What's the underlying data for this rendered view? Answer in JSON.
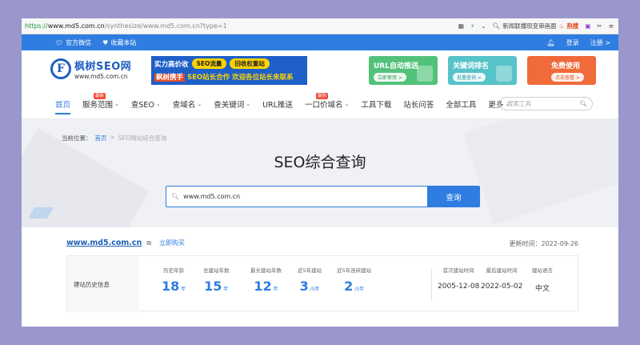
{
  "browser": {
    "url_scheme": "https://",
    "url_host": "www.md5.com.cn",
    "url_path": "/synthesize/www.md5.com.cn?type=1",
    "news_label": "新闻联播现变审画面",
    "hot_label": "热搜"
  },
  "topbar": {
    "wechat_label": "官方微信",
    "bookmark_label": "收藏本站",
    "login_label": "登录",
    "register_label": "注册 >"
  },
  "logo": {
    "name": "枫树SEO网",
    "sub": "www.md5.com.cn"
  },
  "banner_ad": {
    "headline": "实力高价收",
    "pill1": "SEO流量",
    "pill2": "回收权重站",
    "line2_highlight": "枫树携手",
    "line2_rest": "SEO站长合作  欢迎各位站长来联系"
  },
  "promos": [
    {
      "title": "URL自动推送",
      "button": "立即使用 >"
    },
    {
      "title": "关键词排名",
      "button": "批量查询 >"
    },
    {
      "title": "免费使用",
      "button": "点击查看 >"
    }
  ],
  "nav": {
    "items": [
      {
        "label": "首页",
        "active": true
      },
      {
        "label": "服务范围",
        "badge": "最新",
        "chevron": true
      },
      {
        "label": "查SEO",
        "chevron": true
      },
      {
        "label": "查域名",
        "chevron": true
      },
      {
        "label": "查关键词",
        "chevron": true
      },
      {
        "label": "URL推送"
      },
      {
        "label": "一口价域名",
        "badge": "最热",
        "chevron": true
      },
      {
        "label": "工具下载"
      },
      {
        "label": "站长问答"
      },
      {
        "label": "全部工具"
      },
      {
        "label": "更多",
        "chevron": true
      }
    ],
    "search_placeholder": "搜索工具"
  },
  "hero": {
    "crumb_prefix": "当前位置：",
    "crumb_home": "首页",
    "crumb_sep": ">",
    "crumb_current": "SEO网站综合查询",
    "title": "SEO综合查询",
    "search_value": "www.md5.com.cn",
    "search_button": "查询"
  },
  "result": {
    "domain": "www.md5.com.cn",
    "buy_label": "立即购买",
    "updated_label": "更新时间：",
    "updated_value": "2022-09-26",
    "history_label": "建站历史信息",
    "stats": [
      {
        "key": "历史年龄",
        "value": "18",
        "unit": "年"
      },
      {
        "key": "总建站年数",
        "value": "15",
        "unit": "年"
      },
      {
        "key": "最长建站年数",
        "value": "12",
        "unit": "年"
      },
      {
        "key": "近5年建站",
        "value": "3",
        "unit": "/5年"
      },
      {
        "key": "近5年连续建站",
        "value": "2",
        "unit": "/5年"
      }
    ],
    "dates": [
      {
        "key": "首次建站时间",
        "value": "2005-12-08"
      },
      {
        "key": "最后建站时间",
        "value": "2022-05-02"
      },
      {
        "key": "建站语言",
        "value": "中文"
      }
    ]
  }
}
